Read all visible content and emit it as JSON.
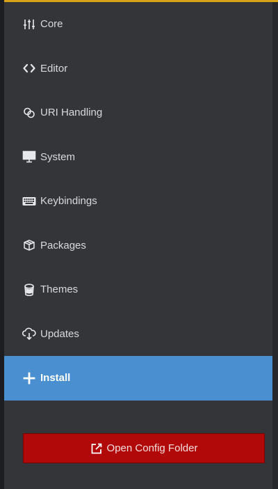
{
  "colors": {
    "accent": "#d9a21b",
    "active_bg": "#4a90d1",
    "danger": "#b1080a",
    "panel_bg": "#333539"
  },
  "nav": {
    "items": [
      {
        "label": "Core",
        "icon": "sliders-icon"
      },
      {
        "label": "Editor",
        "icon": "code-icon"
      },
      {
        "label": "URI Handling",
        "icon": "link-icon"
      },
      {
        "label": "System",
        "icon": "monitor-icon"
      },
      {
        "label": "Keybindings",
        "icon": "keyboard-icon"
      },
      {
        "label": "Packages",
        "icon": "package-icon"
      },
      {
        "label": "Themes",
        "icon": "paint-bucket-icon"
      },
      {
        "label": "Updates",
        "icon": "cloud-download-icon"
      },
      {
        "label": "Install",
        "icon": "plus-icon",
        "active": true
      }
    ]
  },
  "footer": {
    "open_config_label": "Open Config Folder",
    "icon": "external-link-icon"
  }
}
